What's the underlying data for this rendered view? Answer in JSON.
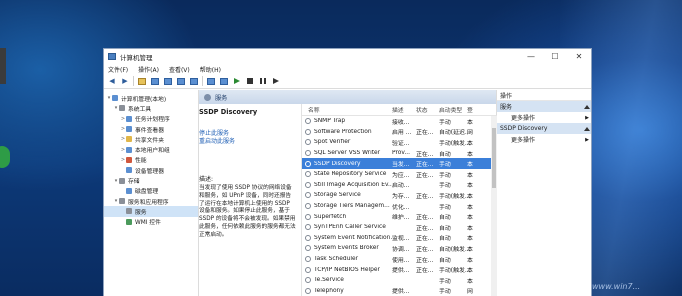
{
  "window": {
    "title": "计算机管理",
    "controls": {
      "minimize": "—",
      "maximize": "☐",
      "close": "✕"
    }
  },
  "menu": [
    "文件(F)",
    "操作(A)",
    "查看(V)",
    "帮助(H)"
  ],
  "tree": [
    {
      "label": "计算机管理(本地)",
      "level": 0,
      "caret": "▾",
      "icon": "computer-icon"
    },
    {
      "label": "系统工具",
      "level": 1,
      "caret": "▾",
      "icon": "tools-icon"
    },
    {
      "label": "任务计划程序",
      "level": 2,
      "caret": ">",
      "icon": "clock-icon"
    },
    {
      "label": "事件查看器",
      "level": 2,
      "caret": ">",
      "icon": "event-icon"
    },
    {
      "label": "共享文件夹",
      "level": 2,
      "caret": ">",
      "icon": "folder-icon"
    },
    {
      "label": "本地用户和组",
      "level": 2,
      "caret": ">",
      "icon": "users-icon"
    },
    {
      "label": "性能",
      "level": 2,
      "caret": ">",
      "icon": "performance-icon"
    },
    {
      "label": "设备管理器",
      "level": 2,
      "caret": "",
      "icon": "device-icon"
    },
    {
      "label": "存储",
      "level": 1,
      "caret": "▾",
      "icon": "storage-icon"
    },
    {
      "label": "磁盘管理",
      "level": 2,
      "caret": "",
      "icon": "disk-icon"
    },
    {
      "label": "服务和应用程序",
      "level": 1,
      "caret": "▾",
      "icon": "apps-icon"
    },
    {
      "label": "服务",
      "level": 2,
      "caret": "",
      "icon": "services-icon",
      "selected": true
    },
    {
      "label": "WMI 控件",
      "level": 2,
      "caret": "",
      "icon": "wmi-icon"
    }
  ],
  "services_header": "服务",
  "detail": {
    "title": "SSDP Discovery",
    "stop_link": "停止此服务",
    "restart_link": "重启动此服务",
    "desc_label": "描述:",
    "desc_text": "当发现了使用 SSDP 协议的网络设备和服务，如 UPnP 设备，同时还报告了运行在本地计算机上使用的 SSDP 设备和服务。如果停止此服务，基于 SSDP 的设备将不会被发现。如果禁用此服务，任何依赖此服务的服务都无法正常启动。"
  },
  "columns": {
    "name": "名称",
    "desc": "描述",
    "status": "状态",
    "startup": "启动类型",
    "logon": "登"
  },
  "services": [
    {
      "name": "SNMP Trap",
      "desc": "接收...",
      "status": "",
      "startup": "手动",
      "logon": "本"
    },
    {
      "name": "Software Protection",
      "desc": "启用 ...",
      "status": "正在...",
      "startup": "自动(延迟...",
      "logon": "网"
    },
    {
      "name": "Spot Verifier",
      "desc": "验证...",
      "status": "",
      "startup": "手动(触发...",
      "logon": "本"
    },
    {
      "name": "SQL Server VSS Writer",
      "desc": "Prov...",
      "status": "正在...",
      "startup": "自动",
      "logon": "本"
    },
    {
      "name": "SSDP Discovery",
      "desc": "当发...",
      "status": "正在...",
      "startup": "手动",
      "logon": "本",
      "selected": true
    },
    {
      "name": "State Repository Service",
      "desc": "为应...",
      "status": "正在...",
      "startup": "手动",
      "logon": "本"
    },
    {
      "name": "Still Image Acquisition Ev...",
      "desc": "启动...",
      "status": "",
      "startup": "手动",
      "logon": "本"
    },
    {
      "name": "Storage Service",
      "desc": "为存...",
      "status": "正在...",
      "startup": "手动(触发...",
      "logon": "本"
    },
    {
      "name": "Storage Tiers Managem...",
      "desc": "优化...",
      "status": "",
      "startup": "手动",
      "logon": "本"
    },
    {
      "name": "Superfetch",
      "desc": "维护...",
      "status": "正在...",
      "startup": "自动",
      "logon": "本"
    },
    {
      "name": "SynTPEnh Caller Service",
      "desc": "",
      "status": "正在...",
      "startup": "自动",
      "logon": "本"
    },
    {
      "name": "System Event Notification...",
      "desc": "监视...",
      "status": "正在...",
      "startup": "自动",
      "logon": "本"
    },
    {
      "name": "System Events Broker",
      "desc": "协调...",
      "status": "正在...",
      "startup": "自动(触发...",
      "logon": "本"
    },
    {
      "name": "Task Scheduler",
      "desc": "使用...",
      "status": "正在...",
      "startup": "自动",
      "logon": "本"
    },
    {
      "name": "TCP/IP NetBIOS Helper",
      "desc": "提供...",
      "status": "正在...",
      "startup": "手动(触发...",
      "logon": "本"
    },
    {
      "name": "Te.Service",
      "desc": "",
      "status": "",
      "startup": "手动",
      "logon": "本"
    },
    {
      "name": "Telephony",
      "desc": "提供...",
      "status": "",
      "startup": "手动",
      "logon": "网"
    }
  ],
  "actions": {
    "header": "操作",
    "sections": [
      {
        "title": "服务",
        "item": "更多操作"
      },
      {
        "title": "SSDP Discovery",
        "item": "更多操作"
      }
    ]
  },
  "watermark": "www.win7..."
}
